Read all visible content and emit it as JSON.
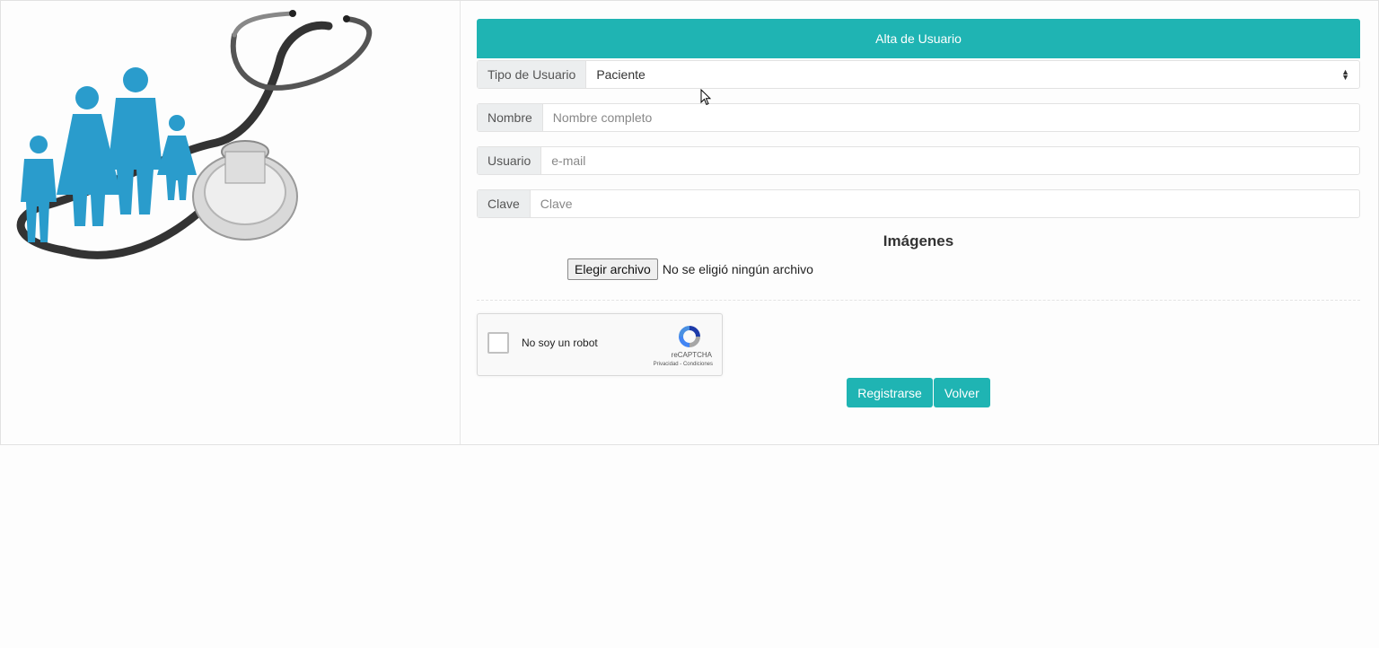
{
  "form": {
    "header": "Alta de Usuario",
    "tipo_label": "Tipo de Usuario",
    "tipo_value": "Paciente",
    "nombre_label": "Nombre",
    "nombre_placeholder": "Nombre completo",
    "usuario_label": "Usuario",
    "usuario_placeholder": "e-mail",
    "clave_label": "Clave",
    "clave_placeholder": "Clave",
    "imagenes_title": "Imágenes",
    "file_button": "Elegir archivo",
    "file_status": "No se eligió ningún archivo"
  },
  "captcha": {
    "label": "No soy un robot",
    "brand": "reCAPTCHA",
    "terms": "Privacidad - Condiciones"
  },
  "actions": {
    "register_label": "Registrarse",
    "back_label": "Volver"
  },
  "colors": {
    "accent": "#1fb4b3",
    "figures": "#2a9ccc"
  },
  "icons": [
    "family-stethoscope-illustration",
    "select-arrows-icon",
    "recaptcha-logo-icon",
    "mouse-cursor-icon"
  ]
}
